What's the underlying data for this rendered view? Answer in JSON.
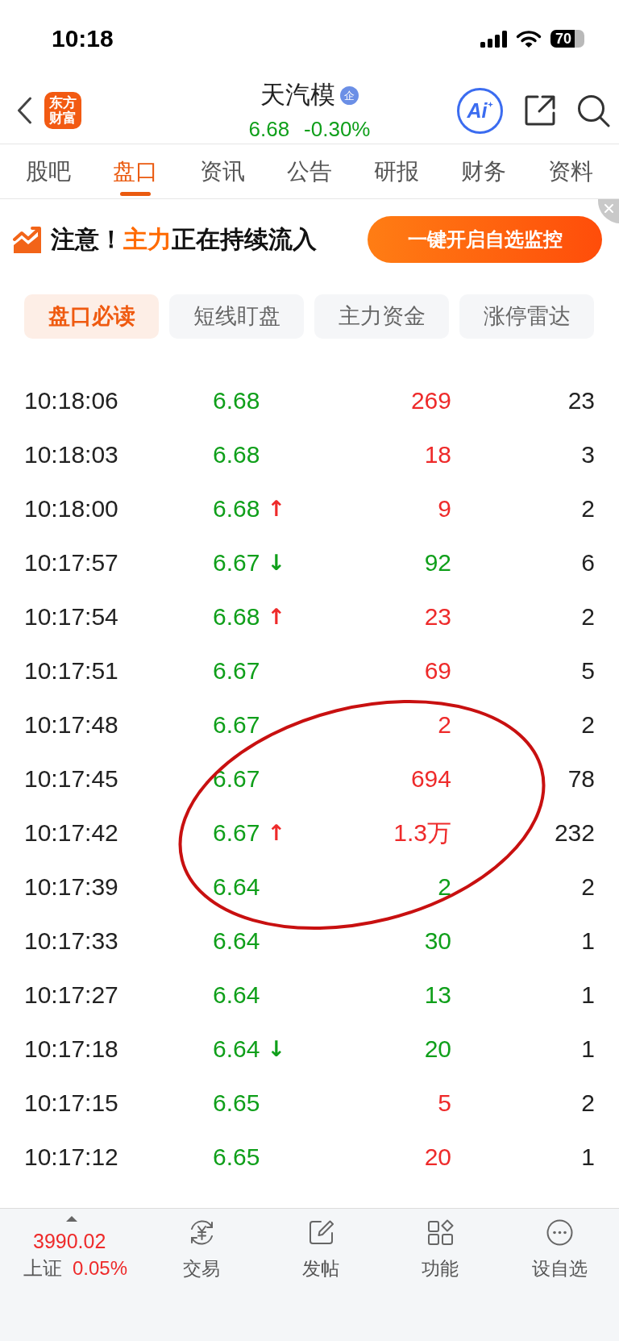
{
  "status_bar": {
    "time": "10:18",
    "battery": "70"
  },
  "header": {
    "logo": [
      "东方",
      "财富"
    ],
    "title": "天汽模",
    "badge": "企",
    "price": "6.68",
    "change": "-0.30%",
    "ai_button": "Ai"
  },
  "tabs": [
    {
      "label": "股吧",
      "selected": false
    },
    {
      "label": "盘口",
      "selected": true
    },
    {
      "label": "资讯",
      "selected": false
    },
    {
      "label": "公告",
      "selected": false
    },
    {
      "label": "研报",
      "selected": false
    },
    {
      "label": "财务",
      "selected": false
    },
    {
      "label": "资料",
      "selected": false
    }
  ],
  "banner": {
    "text_parts": [
      {
        "kind": "plain",
        "text": "注意！"
      },
      {
        "kind": "highlight",
        "text": "主力"
      },
      {
        "kind": "plain",
        "text": "正在持续流入"
      }
    ],
    "button": "一键开启自选监控"
  },
  "chips": [
    {
      "label": "盘口必读",
      "selected": true
    },
    {
      "label": "短线盯盘",
      "selected": false
    },
    {
      "label": "主力资金",
      "selected": false
    },
    {
      "label": "涨停雷达",
      "selected": false
    }
  ],
  "trades": [
    {
      "time": "10:18:06",
      "price": "6.68",
      "volume": "269",
      "buy": true,
      "count": "23"
    },
    {
      "time": "10:18:03",
      "price": "6.68",
      "volume": "18",
      "buy": true,
      "count": "3"
    },
    {
      "time": "10:18:00",
      "price": "6.68",
      "tick": {
        "text": "↑",
        "color": "#ee2a2a"
      },
      "volume": "9",
      "buy": true,
      "count": "2"
    },
    {
      "time": "10:17:57",
      "price": "6.67",
      "tick": {
        "text": "↓",
        "color": "#0f9f1a"
      },
      "volume": "92",
      "buy": false,
      "count": "6"
    },
    {
      "time": "10:17:54",
      "price": "6.68",
      "tick": {
        "text": "↑",
        "color": "#ee2a2a"
      },
      "volume": "23",
      "buy": true,
      "count": "2"
    },
    {
      "time": "10:17:51",
      "price": "6.67",
      "volume": "69",
      "buy": true,
      "count": "5"
    },
    {
      "time": "10:17:48",
      "price": "6.67",
      "volume": "2",
      "buy": true,
      "count": "2"
    },
    {
      "time": "10:17:45",
      "price": "6.67",
      "volume": "694",
      "buy": true,
      "count": "78"
    },
    {
      "time": "10:17:42",
      "price": "6.67",
      "tick": {
        "text": "↑",
        "color": "#ee2a2a"
      },
      "volume": "1.3万",
      "buy": true,
      "count": "232"
    },
    {
      "time": "10:17:39",
      "price": "6.64",
      "volume": "2",
      "buy": false,
      "count": "2"
    },
    {
      "time": "10:17:33",
      "price": "6.64",
      "volume": "30",
      "buy": false,
      "count": "1"
    },
    {
      "time": "10:17:27",
      "price": "6.64",
      "volume": "13",
      "buy": false,
      "count": "1"
    },
    {
      "time": "10:17:18",
      "price": "6.64",
      "tick": {
        "text": "↓",
        "color": "#0f9f1a"
      },
      "volume": "20",
      "buy": false,
      "count": "1"
    },
    {
      "time": "10:17:15",
      "price": "6.65",
      "volume": "5",
      "buy": true,
      "count": "2"
    },
    {
      "time": "10:17:12",
      "price": "6.65",
      "volume": "20",
      "buy": true,
      "count": "1"
    }
  ],
  "bottom_bar": {
    "index_value": "3990.02",
    "index_name": "上证",
    "index_change": "0.05%",
    "items": [
      {
        "kind": "trade",
        "label": "交易"
      },
      {
        "kind": "post",
        "label": "发帖"
      },
      {
        "kind": "functions",
        "label": "功能"
      },
      {
        "kind": "watchlist",
        "label": "设自选"
      }
    ]
  }
}
